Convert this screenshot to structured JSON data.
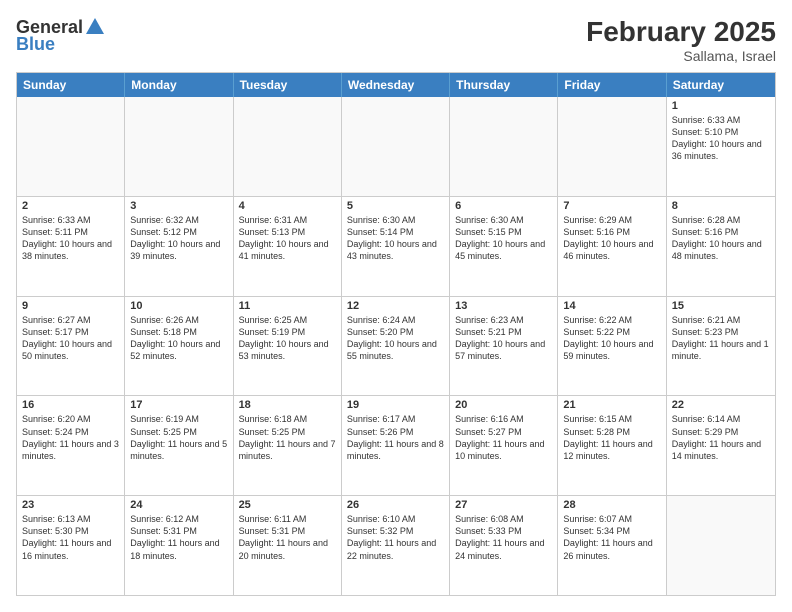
{
  "header": {
    "logo_general": "General",
    "logo_blue": "Blue",
    "main_title": "February 2025",
    "sub_title": "Sallama, Israel"
  },
  "days_of_week": [
    "Sunday",
    "Monday",
    "Tuesday",
    "Wednesday",
    "Thursday",
    "Friday",
    "Saturday"
  ],
  "weeks": [
    [
      {
        "day": "",
        "text": ""
      },
      {
        "day": "",
        "text": ""
      },
      {
        "day": "",
        "text": ""
      },
      {
        "day": "",
        "text": ""
      },
      {
        "day": "",
        "text": ""
      },
      {
        "day": "",
        "text": ""
      },
      {
        "day": "1",
        "text": "Sunrise: 6:33 AM\nSunset: 5:10 PM\nDaylight: 10 hours and 36 minutes."
      }
    ],
    [
      {
        "day": "2",
        "text": "Sunrise: 6:33 AM\nSunset: 5:11 PM\nDaylight: 10 hours and 38 minutes."
      },
      {
        "day": "3",
        "text": "Sunrise: 6:32 AM\nSunset: 5:12 PM\nDaylight: 10 hours and 39 minutes."
      },
      {
        "day": "4",
        "text": "Sunrise: 6:31 AM\nSunset: 5:13 PM\nDaylight: 10 hours and 41 minutes."
      },
      {
        "day": "5",
        "text": "Sunrise: 6:30 AM\nSunset: 5:14 PM\nDaylight: 10 hours and 43 minutes."
      },
      {
        "day": "6",
        "text": "Sunrise: 6:30 AM\nSunset: 5:15 PM\nDaylight: 10 hours and 45 minutes."
      },
      {
        "day": "7",
        "text": "Sunrise: 6:29 AM\nSunset: 5:16 PM\nDaylight: 10 hours and 46 minutes."
      },
      {
        "day": "8",
        "text": "Sunrise: 6:28 AM\nSunset: 5:16 PM\nDaylight: 10 hours and 48 minutes."
      }
    ],
    [
      {
        "day": "9",
        "text": "Sunrise: 6:27 AM\nSunset: 5:17 PM\nDaylight: 10 hours and 50 minutes."
      },
      {
        "day": "10",
        "text": "Sunrise: 6:26 AM\nSunset: 5:18 PM\nDaylight: 10 hours and 52 minutes."
      },
      {
        "day": "11",
        "text": "Sunrise: 6:25 AM\nSunset: 5:19 PM\nDaylight: 10 hours and 53 minutes."
      },
      {
        "day": "12",
        "text": "Sunrise: 6:24 AM\nSunset: 5:20 PM\nDaylight: 10 hours and 55 minutes."
      },
      {
        "day": "13",
        "text": "Sunrise: 6:23 AM\nSunset: 5:21 PM\nDaylight: 10 hours and 57 minutes."
      },
      {
        "day": "14",
        "text": "Sunrise: 6:22 AM\nSunset: 5:22 PM\nDaylight: 10 hours and 59 minutes."
      },
      {
        "day": "15",
        "text": "Sunrise: 6:21 AM\nSunset: 5:23 PM\nDaylight: 11 hours and 1 minute."
      }
    ],
    [
      {
        "day": "16",
        "text": "Sunrise: 6:20 AM\nSunset: 5:24 PM\nDaylight: 11 hours and 3 minutes."
      },
      {
        "day": "17",
        "text": "Sunrise: 6:19 AM\nSunset: 5:25 PM\nDaylight: 11 hours and 5 minutes."
      },
      {
        "day": "18",
        "text": "Sunrise: 6:18 AM\nSunset: 5:25 PM\nDaylight: 11 hours and 7 minutes."
      },
      {
        "day": "19",
        "text": "Sunrise: 6:17 AM\nSunset: 5:26 PM\nDaylight: 11 hours and 8 minutes."
      },
      {
        "day": "20",
        "text": "Sunrise: 6:16 AM\nSunset: 5:27 PM\nDaylight: 11 hours and 10 minutes."
      },
      {
        "day": "21",
        "text": "Sunrise: 6:15 AM\nSunset: 5:28 PM\nDaylight: 11 hours and 12 minutes."
      },
      {
        "day": "22",
        "text": "Sunrise: 6:14 AM\nSunset: 5:29 PM\nDaylight: 11 hours and 14 minutes."
      }
    ],
    [
      {
        "day": "23",
        "text": "Sunrise: 6:13 AM\nSunset: 5:30 PM\nDaylight: 11 hours and 16 minutes."
      },
      {
        "day": "24",
        "text": "Sunrise: 6:12 AM\nSunset: 5:31 PM\nDaylight: 11 hours and 18 minutes."
      },
      {
        "day": "25",
        "text": "Sunrise: 6:11 AM\nSunset: 5:31 PM\nDaylight: 11 hours and 20 minutes."
      },
      {
        "day": "26",
        "text": "Sunrise: 6:10 AM\nSunset: 5:32 PM\nDaylight: 11 hours and 22 minutes."
      },
      {
        "day": "27",
        "text": "Sunrise: 6:08 AM\nSunset: 5:33 PM\nDaylight: 11 hours and 24 minutes."
      },
      {
        "day": "28",
        "text": "Sunrise: 6:07 AM\nSunset: 5:34 PM\nDaylight: 11 hours and 26 minutes."
      },
      {
        "day": "",
        "text": ""
      }
    ]
  ]
}
